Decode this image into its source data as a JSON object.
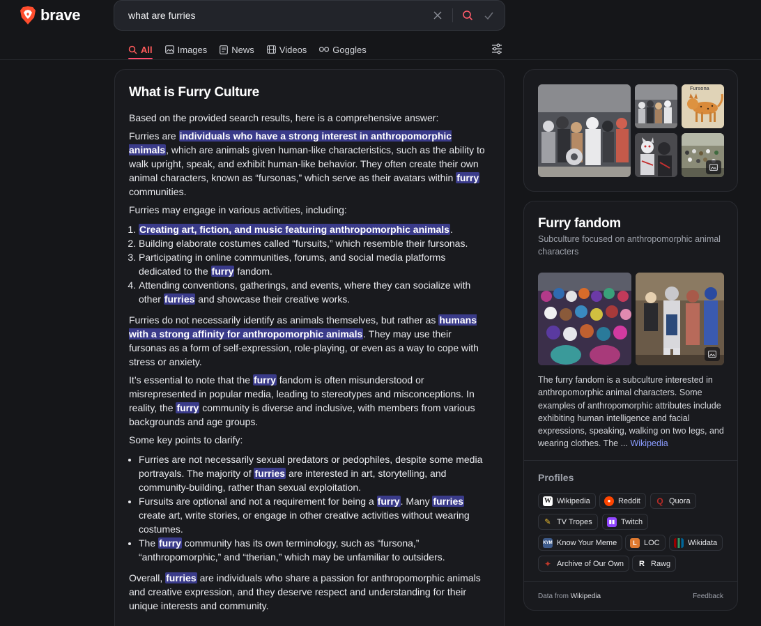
{
  "brand": {
    "name": "brave",
    "accent": "#ff4d2d"
  },
  "search": {
    "query": "what are furries"
  },
  "tabs": [
    {
      "label": "All",
      "icon": "search-icon"
    },
    {
      "label": "Images",
      "icon": "image-icon"
    },
    {
      "label": "News",
      "icon": "news-icon"
    },
    {
      "label": "Videos",
      "icon": "video-icon"
    },
    {
      "label": "Goggles",
      "icon": "goggles-icon"
    }
  ],
  "answer": {
    "title": "What is Furry Culture",
    "intro": "Based on the provided search results, here is a comprehensive answer:",
    "p1": {
      "a": "Furries are ",
      "h1": "individuals who have a strong interest in anthropomorphic animals",
      "b": ", which are animals given human-like characteristics, such as the ability to walk upright, speak, and exhibit human-like behavior. They often create their own animal characters, known as “fursonas,” which serve as their avatars within ",
      "h2": "furry",
      "c": " communities."
    },
    "activities_intro": "Furries may engage in various activities, including:",
    "activities": {
      "a1": {
        "h": "Creating art, fiction, and music featuring anthropomorphic animals",
        "t": "."
      },
      "a2": "Building elaborate costumes called “fursuits,” which resemble their fursonas.",
      "a3": {
        "a": "Participating in online communities, forums, and social media platforms dedicated to the ",
        "h": "furry",
        "b": " fandom."
      },
      "a4": {
        "a": "Attending conventions, gatherings, and events, where they can socialize with other ",
        "h": "furries",
        "b": " and showcase their creative works."
      }
    },
    "p2": {
      "a": "Furries do not necessarily identify as animals themselves, but rather as ",
      "h": "humans with a strong affinity for anthropomorphic animals",
      "b": ". They may use their fursonas as a form of self-expression, role-playing, or even as a way to cope with stress or anxiety."
    },
    "p3": {
      "a": "It’s essential to note that the ",
      "h1": "furry",
      "b": " fandom is often misunderstood or misrepresented in popular media, leading to stereotypes and misconceptions. In reality, the ",
      "h2": "furry",
      "c": " community is diverse and inclusive, with members from various backgrounds and age groups."
    },
    "points_intro": "Some key points to clarify:",
    "points": {
      "b1": {
        "a": "Furries are not necessarily sexual predators or pedophiles, despite some media portrayals. The majority of ",
        "h": "furries",
        "b": " are interested in art, storytelling, and community-building, rather than sexual exploitation."
      },
      "b2": {
        "a": "Fursuits are optional and not a requirement for being a ",
        "h1": "furry",
        "b": ". Many ",
        "h2": "furries",
        "c": " create art, write stories, or engage in other creative activities without wearing costumes."
      },
      "b3": {
        "a": "The ",
        "h": "furry",
        "b": " community has its own terminology, such as “fursona,” “anthropomorphic,” and “therian,” which may be unfamiliar to outsiders."
      }
    },
    "p4": {
      "a": "Overall, ",
      "h": "furries",
      "b": " are individuals who share a passion for anthropomorphic animals and creative expression, and they deserve respect and understanding for their unique interests and community."
    }
  },
  "knowledge_panel": {
    "title": "Furry fandom",
    "subtitle": "Subculture focused on anthropomorphic animal characters",
    "description": "The furry fandom is a subculture interested in anthropomorphic animal characters. Some examples of anthropomorphic attributes include exhibiting human intelligence and facial expressions, speaking, walking on two legs, and wearing clothes. The ... ",
    "source_link": "Wikipedia",
    "profiles_title": "Profiles",
    "profiles": [
      {
        "label": "Wikipedia",
        "icon": "wikipedia-icon"
      },
      {
        "label": "Reddit",
        "icon": "reddit-icon"
      },
      {
        "label": "Quora",
        "icon": "quora-icon"
      },
      {
        "label": "TV Tropes",
        "icon": "tvtropes-icon"
      },
      {
        "label": "Twitch",
        "icon": "twitch-icon"
      },
      {
        "label": "Know Your Meme",
        "icon": "knowyourmeme-icon"
      },
      {
        "label": "LOC",
        "icon": "loc-icon"
      },
      {
        "label": "Wikidata",
        "icon": "wikidata-icon"
      },
      {
        "label": "Archive of Our Own",
        "icon": "ao3-icon"
      },
      {
        "label": "Rawg",
        "icon": "rawg-icon"
      }
    ],
    "footer_prefix": "Data from ",
    "footer_source": "Wikipedia",
    "feedback": "Feedback"
  },
  "images": {
    "thumb_caption": "Fursona"
  }
}
